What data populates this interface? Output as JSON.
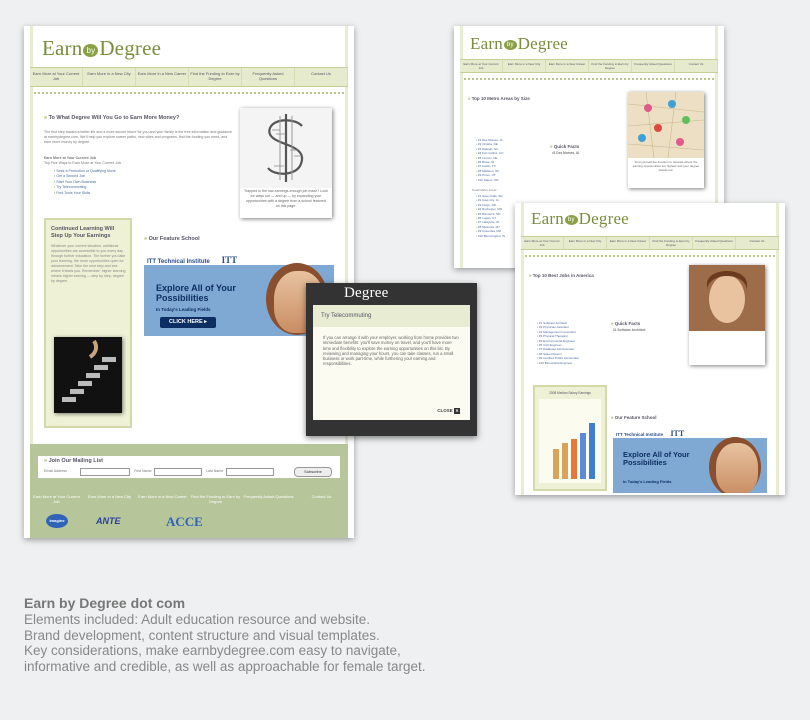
{
  "brand": {
    "earn": "Earn",
    "by": "by",
    "degree": "Degree"
  },
  "nav": [
    "Earn More at Your Current Job",
    "Earn More in a New City",
    "Earn More in a New Career",
    "Find the Funding to Earn by Degree",
    "Frequently Asked Questions",
    "Contact Us"
  ],
  "nav_short": [
    "Earn More at Your Current Job",
    "Earn More in a New City",
    "Earn More in a New Career",
    "Find the Funding to Earn by Degree",
    "Frequently Asked Questions",
    "Contact Us"
  ],
  "page1": {
    "heading": "To What Degree Will You Go to Earn More Money?",
    "intro": "The first step toward a better life and a more secure future for you and your family is the free information and guidance at earnbydegree.com. We'll help you explore career paths, new cities and programs, find the funding you need, and earn more money by degree.",
    "sub_heading": "Earn More at Your Current Job",
    "sub_text": "Top Five Ways to Earn More at Your Current Job",
    "links": [
      "Seek a Promotion or Qualifying Move",
      "Get a Second Job",
      "Start Your Own Business",
      "Try Telecommuting",
      "Find Tools Your Skills"
    ],
    "photo_caption": "Trapped in the low-earnings-enough job maze? Look for ways out — and up — by expanding your opportunities with a degree from a school featured on this page.",
    "side_title": "Continued Learning Will Step Up Your Earnings",
    "side_text": "Whatever your current situation, additional opportunities are accessible to you every day through further education. The further you take your learning, the more opportunities open for advancement. Take the next step and see where it leads you. Remember: higher learning means higher earning — step by step, degree by degree.",
    "feature_heading": "Our Feature School",
    "ad": {
      "school": "ITT Technical Institute",
      "logo": "ITT",
      "tagline": "Explore All of Your Possibilities",
      "sub": "In Today's Leading Fields",
      "button": "CLICK HERE ▸"
    },
    "mailing": {
      "heading": "Join Our Mailing List",
      "email": "Email Address",
      "first": "First Name",
      "last": "Last Name",
      "submit": "Subscribe"
    },
    "badges": [
      "Imagine",
      "ANTE",
      "ACCE"
    ]
  },
  "popup": {
    "brand": "Degree",
    "title": "Try Telecommuting",
    "body": "If you can arrange it with your employer, working from home provides two immediate benefits: you'll save money on travel, and you'll have more time and flexibility to explore the earning opportunities on this list. By reviewing and managing your hours, you can take classes, run a small business or work part-time, while furthering your earning and responsibilities.",
    "close": "CLOSE"
  },
  "page2": {
    "heading": "Top 10 Metro Areas by Size",
    "quick_title": "Quick Facts",
    "quick_sub": "#1 Des Moines, IA",
    "cities": [
      "#1 Des Moines, IA",
      "#2 Omaha, NE",
      "#3 Raleigh, NC",
      "#4 Fort Collins, CO",
      "#5 Lincoln, NE",
      "#6 Boise, ID",
      "#7 Austin, TX",
      "#8 Madison, WI",
      "#9 Provo, UT",
      "#10 Salem, OR"
    ],
    "small_label": "Small Metro Areas",
    "small": [
      "#1 Sioux Falls, SD",
      "#2 Iowa City, IA",
      "#3 Fargo, ND",
      "#4 Rochester, MN",
      "#5 Bismarck, ND",
      "#6 Logan, UT",
      "#7 Lafayette, IN",
      "#8 Missoula, MT",
      "#9 Columbia, MO",
      "#10 Bloomington, IN"
    ],
    "photo_caption": "Find yourself the freedom to relocate where the earning opportunities are highest and your degree stands out."
  },
  "page3": {
    "heading": "Top 10 Best Jobs in America",
    "jobs": [
      "#1 Software Architect",
      "#2 Physician Assistant",
      "#3 Management Consultant",
      "#4 Physical Therapist",
      "#5 Environmental Engineer",
      "#6 Civil Engineer",
      "#7 Database Administrator",
      "#8 Sales Director",
      "#9 Certified Public Accountant",
      "#10 Biomedical Engineer"
    ],
    "quick_title": "Quick Facts",
    "quick_sub": "#1 Software Architect",
    "chart_title": "2008 Median Salary Earnings",
    "feature_heading": "Our Feature School",
    "ad": {
      "school": "ITT Technical Institute",
      "logo": "ITT",
      "tagline": "Explore All of Your Possibilities",
      "sub": "In Today's Leading Fields"
    }
  },
  "description": {
    "title": "Earn by Degree dot com",
    "lines": [
      "Elements included: Adult education resource and website.",
      "Brand development, content structure and visual templates.",
      "Key considerations, make earnbydegree.com easy to navigate,",
      "informative and credible, as well as approachable for female target."
    ]
  },
  "colors": {
    "brand_green": "#7b8d3d",
    "nav_bg": "#e6ebcd",
    "footer_bg": "#b6c59a",
    "ad_navy": "#0d2e63"
  }
}
